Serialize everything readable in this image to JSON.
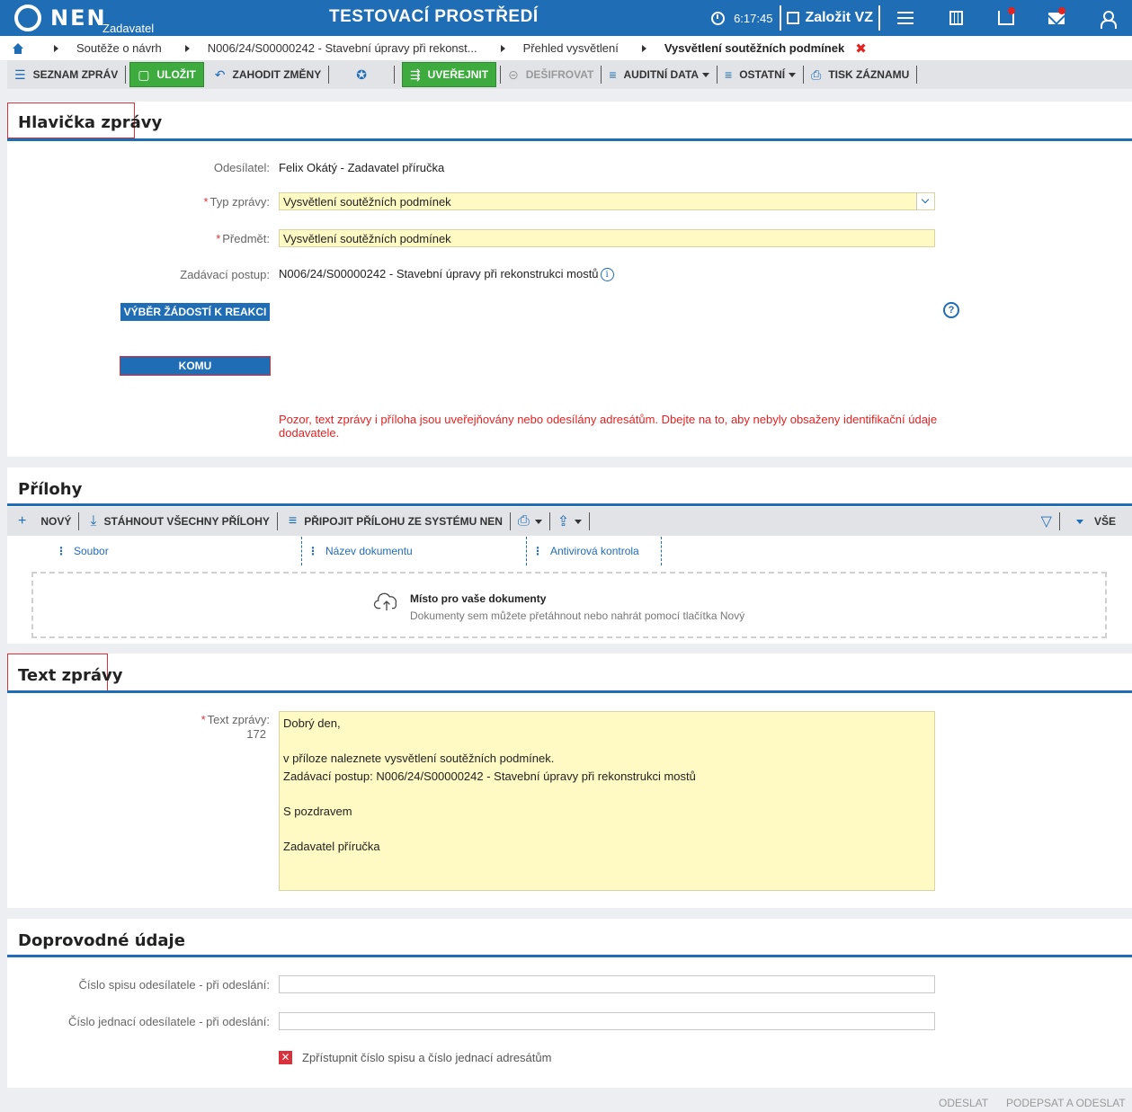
{
  "topbar": {
    "logo": "NEN",
    "logo_sub": "Zadavatel",
    "env_title": "TESTOVACÍ PROSTŘEDÍ",
    "time": "6:17:45",
    "create_label": "Založit VZ"
  },
  "breadcrumb": {
    "items": [
      "Soutěže o návrh",
      "N006/24/S00000242 - Stavební úpravy při rekonst...",
      "Přehled vysvětlení"
    ],
    "current": "Vysvětlení soutěžních podmínek",
    "close": "✖"
  },
  "toolbar": {
    "list": "SEZNAM ZPRÁV",
    "save": "ULOŽIT",
    "discard": "ZAHODIT ZMĚNY",
    "publish": "UVEŘEJNIT",
    "decrypt": "DEŠIFROVAT",
    "audit": "AUDITNÍ DATA",
    "other": "OSTATNÍ",
    "print": "TISK ZÁZNAMU"
  },
  "header_section": {
    "title": "Hlavička zprávy",
    "sender_label": "Odesílatel:",
    "sender_value": "Felix Okátý - Zadavatel příručka",
    "type_label": "Typ zprávy:",
    "type_value": "Vysvětlení soutěžních podmínek",
    "subject_label": "Předmět:",
    "subject_value": "Vysvětlení soutěžních podmínek",
    "procedure_label": "Zadávací postup:",
    "procedure_value": "N006/24/S00000242 - Stavební úpravy při rekonstrukci mostů",
    "select_requests_button": "VÝBĚR ŽÁDOSTÍ K REAKCI",
    "to_button": "KOMU",
    "warning_line1": "Pozor, text zprávy i příloha jsou uveřejňovány nebo odesílány adresátům. Dbejte na to, aby nebyly obsaženy identifikační údaje",
    "warning_line2": "dodavatele."
  },
  "attachments": {
    "title": "Přílohy",
    "new": "NOVÝ",
    "download_all": "STÁHNOUT VŠECHNY PŘÍLOHY",
    "attach_from_system": "PŘIPOJIT PŘÍLOHU ZE SYSTÉMU NEN",
    "all": "VŠE",
    "columns": [
      "Soubor",
      "Název dokumentu",
      "Antivirová kontrola"
    ],
    "dropzone_title": "Místo pro vaše dokumenty",
    "dropzone_sub": "Dokumenty sem můžete přetáhnout nebo nahrát pomocí tlačítka Nový"
  },
  "message_text": {
    "title": "Text zprávy",
    "label": "Text zprávy:",
    "count": "172",
    "body": "Dobrý den,\n\nv příloze naleznete vysvětlení soutěžních podmínek.\nZadávací postup: N006/24/S00000242 - Stavební úpravy při rekonstrukci mostů\n\nS pozdravem\n\nZadavatel příručka"
  },
  "accompanying": {
    "title": "Doprovodné údaje",
    "file_no_label": "Číslo spisu odesílatele - při odeslání:",
    "file_no_value": "",
    "ref_no_label": "Číslo jednací odesílatele - při odeslání:",
    "ref_no_value": "",
    "checkbox_label": "Zpřístupnit číslo spisu a číslo jednací adresátům"
  },
  "footer": {
    "send": "ODESLAT",
    "sign_send": "PODEPSAT A ODESLAT"
  },
  "colors": {
    "primary": "#1f6db4",
    "green": "#3eab3e",
    "required": "#d9323c",
    "warning": "#e32222",
    "input_yellow": "#fff9c4"
  }
}
